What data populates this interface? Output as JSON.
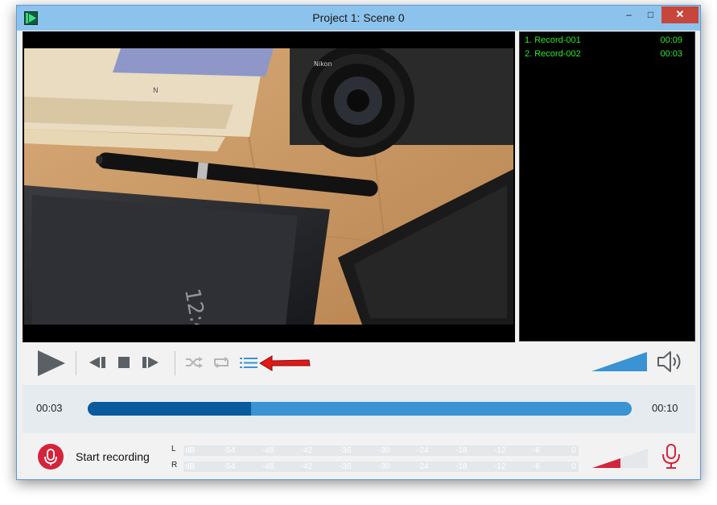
{
  "window": {
    "title": "Project 1: Scene 0",
    "minimize_glyph": "–",
    "maximize_glyph": "□",
    "close_glyph": "✕",
    "icon": "app-film-icon"
  },
  "video": {
    "content": "Photo of a camera lens, a pen, books, a tablet and a notebook on a wooden desk"
  },
  "playlist": {
    "items": [
      {
        "name": "1. Record-001",
        "duration": "00:09"
      },
      {
        "name": "2. Record-002",
        "duration": "00:03"
      }
    ]
  },
  "controls": {
    "buttons": [
      "play-icon",
      "previous-icon",
      "stop-icon",
      "next-icon",
      "shuffle-icon",
      "repeat-icon",
      "playlist-icon"
    ],
    "annotation_arrow_color": "#e01818",
    "volume_level": 1.0,
    "volume_icon": "speaker-icon",
    "accent": "#3a93d2"
  },
  "progress": {
    "current": "00:03",
    "total": "00:10",
    "fraction": 0.3,
    "played_color": "#0a5a9e",
    "remaining_color": "#3a93d2"
  },
  "recording": {
    "start_label": "Start recording",
    "mic_color": "#d4243c",
    "mic_level": 0.5,
    "meter": {
      "left_label": "L",
      "right_label": "R",
      "ticks": [
        "dB",
        "-54",
        "-48",
        "-42",
        "-36",
        "-30",
        "-24",
        "-18",
        "-12",
        "-6",
        "0"
      ]
    }
  }
}
